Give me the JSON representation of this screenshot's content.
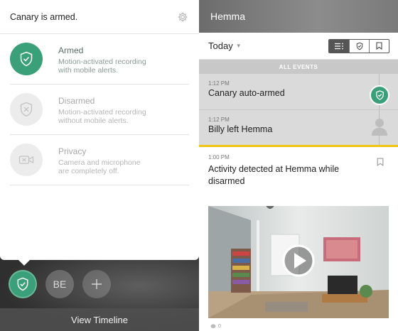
{
  "left": {
    "status_title": "Canary is armed.",
    "modes": [
      {
        "name": "Armed",
        "desc1": "Motion-activated recording",
        "desc2": "with mobile alerts.",
        "icon": "shield-check-icon",
        "active": true
      },
      {
        "name": "Disarmed",
        "desc1": "Motion-activated recording",
        "desc2": "without mobile alerts.",
        "icon": "shield-x-icon",
        "active": false
      },
      {
        "name": "Privacy",
        "desc1": "Camera and microphone",
        "desc2": "are completely off.",
        "icon": "camera-off-icon",
        "active": false
      }
    ],
    "bottom": {
      "initials": "BE",
      "view_timeline": "View Timeline"
    }
  },
  "right": {
    "header_title": "Hemma",
    "filter_label": "Today",
    "section_label": "ALL EVENTS",
    "events": [
      {
        "time": "1:12 PM",
        "label": "Canary auto-armed",
        "icon": "shield-check-icon"
      },
      {
        "time": "1:12 PM",
        "label": "Billy left Hemma",
        "icon": "person-icon"
      }
    ],
    "activity": {
      "time": "1:00 PM",
      "label": "Activity detected at Hemma while disarmed"
    },
    "footer_count": "0"
  },
  "colors": {
    "accent_green": "#3aa079",
    "highlight_yellow": "#f1c40f"
  }
}
